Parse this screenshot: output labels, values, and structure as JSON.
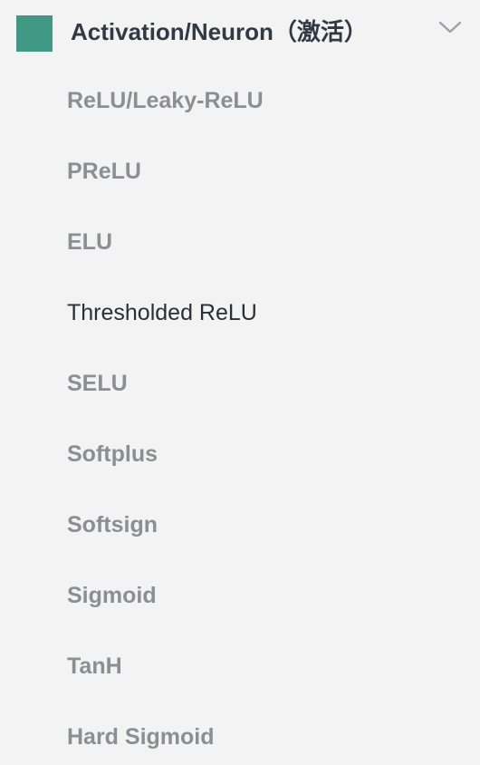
{
  "group": {
    "title": "Activation/Neuron（激活）",
    "swatch_color": "#3f9985",
    "expand_icon": "chevron-down-icon",
    "expanded": true
  },
  "items": [
    {
      "label": "ReLU/Leaky-ReLU",
      "active": false
    },
    {
      "label": "PReLU",
      "active": false
    },
    {
      "label": "ELU",
      "active": false
    },
    {
      "label": "Thresholded ReLU",
      "active": true
    },
    {
      "label": "SELU",
      "active": false
    },
    {
      "label": "Softplus",
      "active": false
    },
    {
      "label": "Softsign",
      "active": false
    },
    {
      "label": "Sigmoid",
      "active": false
    },
    {
      "label": "TanH",
      "active": false
    },
    {
      "label": "Hard Sigmoid",
      "active": false
    }
  ]
}
